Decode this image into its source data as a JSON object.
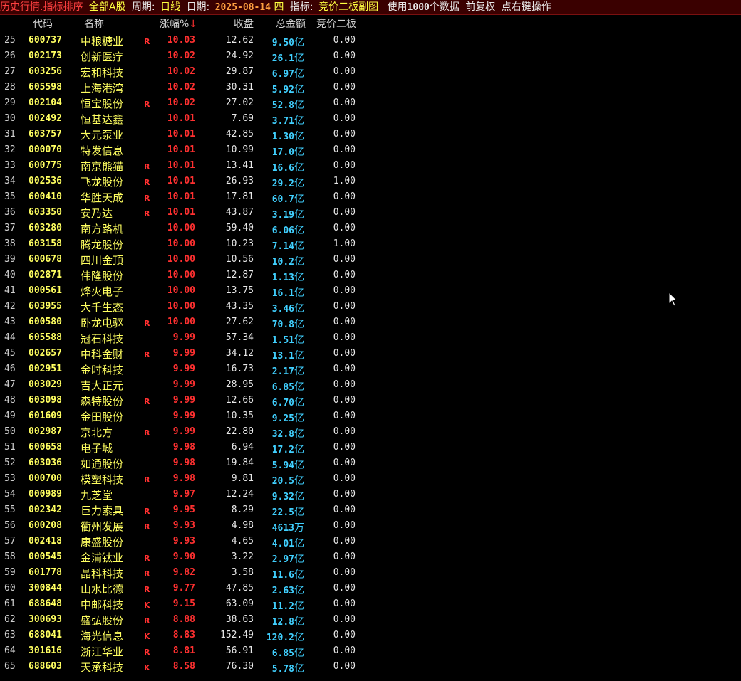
{
  "titlebar": {
    "app": "历史行情.指标排序",
    "market": "全部A股",
    "period_label": "周期:",
    "period_value": "日线",
    "date_label": "日期:",
    "date_value": "2025-08-14",
    "weekday": "四",
    "indicator_label": "指标:",
    "indicator_value": "竞价二板副图",
    "use_prefix": "使用",
    "data_count": "1000",
    "use_suffix": "个数据",
    "adjust": "前复权",
    "hint": "点右键操作"
  },
  "columns": {
    "code": "代码",
    "name": "名称",
    "pct": "涨幅%",
    "sort_arrow": "↓",
    "close": "收盘",
    "amount": "总金额",
    "bid": "竞价二板"
  },
  "colors": {
    "background": "#000000",
    "code": "#ffff60",
    "pct": "#ff3030",
    "amount": "#40d0ff",
    "titlebar_bg": "#3a0000"
  },
  "rows": [
    {
      "no": "25",
      "code": "600737",
      "name": "中粮糖业",
      "flag": "R",
      "pct": "10.03",
      "close": "12.62",
      "amount": "9.50",
      "unit": "亿",
      "bid": "0.00"
    },
    {
      "no": "26",
      "code": "002173",
      "name": "创新医疗",
      "flag": "",
      "pct": "10.02",
      "close": "24.92",
      "amount": "26.1",
      "unit": "亿",
      "bid": "0.00"
    },
    {
      "no": "27",
      "code": "603256",
      "name": "宏和科技",
      "flag": "",
      "pct": "10.02",
      "close": "29.87",
      "amount": "6.97",
      "unit": "亿",
      "bid": "0.00"
    },
    {
      "no": "28",
      "code": "605598",
      "name": "上海港湾",
      "flag": "",
      "pct": "10.02",
      "close": "30.31",
      "amount": "5.92",
      "unit": "亿",
      "bid": "0.00"
    },
    {
      "no": "29",
      "code": "002104",
      "name": "恒宝股份",
      "flag": "R",
      "pct": "10.02",
      "close": "27.02",
      "amount": "52.8",
      "unit": "亿",
      "bid": "0.00"
    },
    {
      "no": "30",
      "code": "002492",
      "name": "恒基达鑫",
      "flag": "",
      "pct": "10.01",
      "close": "7.69",
      "amount": "3.71",
      "unit": "亿",
      "bid": "0.00"
    },
    {
      "no": "31",
      "code": "603757",
      "name": "大元泵业",
      "flag": "",
      "pct": "10.01",
      "close": "42.85",
      "amount": "1.30",
      "unit": "亿",
      "bid": "0.00"
    },
    {
      "no": "32",
      "code": "000070",
      "name": "特发信息",
      "flag": "",
      "pct": "10.01",
      "close": "10.99",
      "amount": "17.0",
      "unit": "亿",
      "bid": "0.00"
    },
    {
      "no": "33",
      "code": "600775",
      "name": "南京熊猫",
      "flag": "R",
      "pct": "10.01",
      "close": "13.41",
      "amount": "16.6",
      "unit": "亿",
      "bid": "0.00"
    },
    {
      "no": "34",
      "code": "002536",
      "name": "飞龙股份",
      "flag": "R",
      "pct": "10.01",
      "close": "26.93",
      "amount": "29.2",
      "unit": "亿",
      "bid": "1.00"
    },
    {
      "no": "35",
      "code": "600410",
      "name": "华胜天成",
      "flag": "R",
      "pct": "10.01",
      "close": "17.81",
      "amount": "60.7",
      "unit": "亿",
      "bid": "0.00"
    },
    {
      "no": "36",
      "code": "603350",
      "name": "安乃达",
      "flag": "R",
      "pct": "10.01",
      "close": "43.87",
      "amount": "3.19",
      "unit": "亿",
      "bid": "0.00"
    },
    {
      "no": "37",
      "code": "603280",
      "name": "南方路机",
      "flag": "",
      "pct": "10.00",
      "close": "59.40",
      "amount": "6.06",
      "unit": "亿",
      "bid": "0.00"
    },
    {
      "no": "38",
      "code": "603158",
      "name": "腾龙股份",
      "flag": "",
      "pct": "10.00",
      "close": "10.23",
      "amount": "7.14",
      "unit": "亿",
      "bid": "1.00"
    },
    {
      "no": "39",
      "code": "600678",
      "name": "四川金顶",
      "flag": "",
      "pct": "10.00",
      "close": "10.56",
      "amount": "10.2",
      "unit": "亿",
      "bid": "0.00"
    },
    {
      "no": "40",
      "code": "002871",
      "name": "伟隆股份",
      "flag": "",
      "pct": "10.00",
      "close": "12.87",
      "amount": "1.13",
      "unit": "亿",
      "bid": "0.00"
    },
    {
      "no": "41",
      "code": "000561",
      "name": "烽火电子",
      "flag": "",
      "pct": "10.00",
      "close": "13.75",
      "amount": "16.1",
      "unit": "亿",
      "bid": "0.00"
    },
    {
      "no": "42",
      "code": "603955",
      "name": "大千生态",
      "flag": "",
      "pct": "10.00",
      "close": "43.35",
      "amount": "3.46",
      "unit": "亿",
      "bid": "0.00"
    },
    {
      "no": "43",
      "code": "600580",
      "name": "卧龙电驱",
      "flag": "R",
      "pct": "10.00",
      "close": "27.62",
      "amount": "70.8",
      "unit": "亿",
      "bid": "0.00"
    },
    {
      "no": "44",
      "code": "605588",
      "name": "冠石科技",
      "flag": "",
      "pct": "9.99",
      "close": "57.34",
      "amount": "1.51",
      "unit": "亿",
      "bid": "0.00"
    },
    {
      "no": "45",
      "code": "002657",
      "name": "中科金财",
      "flag": "R",
      "pct": "9.99",
      "close": "34.12",
      "amount": "13.1",
      "unit": "亿",
      "bid": "0.00"
    },
    {
      "no": "46",
      "code": "002951",
      "name": "金时科技",
      "flag": "",
      "pct": "9.99",
      "close": "16.73",
      "amount": "2.17",
      "unit": "亿",
      "bid": "0.00"
    },
    {
      "no": "47",
      "code": "003029",
      "name": "吉大正元",
      "flag": "",
      "pct": "9.99",
      "close": "28.95",
      "amount": "6.85",
      "unit": "亿",
      "bid": "0.00"
    },
    {
      "no": "48",
      "code": "603098",
      "name": "森特股份",
      "flag": "R",
      "pct": "9.99",
      "close": "12.66",
      "amount": "6.70",
      "unit": "亿",
      "bid": "0.00"
    },
    {
      "no": "49",
      "code": "601609",
      "name": "金田股份",
      "flag": "",
      "pct": "9.99",
      "close": "10.35",
      "amount": "9.25",
      "unit": "亿",
      "bid": "0.00"
    },
    {
      "no": "50",
      "code": "002987",
      "name": "京北方",
      "flag": "R",
      "pct": "9.99",
      "close": "22.80",
      "amount": "32.8",
      "unit": "亿",
      "bid": "0.00"
    },
    {
      "no": "51",
      "code": "600658",
      "name": "电子城",
      "flag": "",
      "pct": "9.98",
      "close": "6.94",
      "amount": "17.2",
      "unit": "亿",
      "bid": "0.00"
    },
    {
      "no": "52",
      "code": "603036",
      "name": "如通股份",
      "flag": "",
      "pct": "9.98",
      "close": "19.84",
      "amount": "5.94",
      "unit": "亿",
      "bid": "0.00"
    },
    {
      "no": "53",
      "code": "000700",
      "name": "模塑科技",
      "flag": "R",
      "pct": "9.98",
      "close": "9.81",
      "amount": "20.5",
      "unit": "亿",
      "bid": "0.00"
    },
    {
      "no": "54",
      "code": "000989",
      "name": "九芝堂",
      "flag": "",
      "pct": "9.97",
      "close": "12.24",
      "amount": "9.32",
      "unit": "亿",
      "bid": "0.00"
    },
    {
      "no": "55",
      "code": "002342",
      "name": "巨力索具",
      "flag": "R",
      "pct": "9.95",
      "close": "8.29",
      "amount": "22.5",
      "unit": "亿",
      "bid": "0.00"
    },
    {
      "no": "56",
      "code": "600208",
      "name": "衢州发展",
      "flag": "R",
      "pct": "9.93",
      "close": "4.98",
      "amount": "4613",
      "unit": "万",
      "bid": "0.00"
    },
    {
      "no": "57",
      "code": "002418",
      "name": "康盛股份",
      "flag": "",
      "pct": "9.93",
      "close": "4.65",
      "amount": "4.01",
      "unit": "亿",
      "bid": "0.00"
    },
    {
      "no": "58",
      "code": "000545",
      "name": "金浦钛业",
      "flag": "R",
      "pct": "9.90",
      "close": "3.22",
      "amount": "2.97",
      "unit": "亿",
      "bid": "0.00"
    },
    {
      "no": "59",
      "code": "601778",
      "name": "晶科科技",
      "flag": "R",
      "pct": "9.82",
      "close": "3.58",
      "amount": "11.6",
      "unit": "亿",
      "bid": "0.00"
    },
    {
      "no": "60",
      "code": "300844",
      "name": "山水比德",
      "flag": "R",
      "pct": "9.77",
      "close": "47.85",
      "amount": "2.63",
      "unit": "亿",
      "bid": "0.00"
    },
    {
      "no": "61",
      "code": "688648",
      "name": "中邮科技",
      "flag": "K",
      "pct": "9.15",
      "close": "63.09",
      "amount": "11.2",
      "unit": "亿",
      "bid": "0.00"
    },
    {
      "no": "62",
      "code": "300693",
      "name": "盛弘股份",
      "flag": "R",
      "pct": "8.88",
      "close": "38.63",
      "amount": "12.8",
      "unit": "亿",
      "bid": "0.00"
    },
    {
      "no": "63",
      "code": "688041",
      "name": "海光信息",
      "flag": "K",
      "pct": "8.83",
      "close": "152.49",
      "amount": "120.2",
      "unit": "亿",
      "bid": "0.00"
    },
    {
      "no": "64",
      "code": "301616",
      "name": "浙江华业",
      "flag": "R",
      "pct": "8.81",
      "close": "56.91",
      "amount": "6.85",
      "unit": "亿",
      "bid": "0.00"
    },
    {
      "no": "65",
      "code": "688603",
      "name": "天承科技",
      "flag": "K",
      "pct": "8.58",
      "close": "76.30",
      "amount": "5.78",
      "unit": "亿",
      "bid": "0.00"
    }
  ]
}
